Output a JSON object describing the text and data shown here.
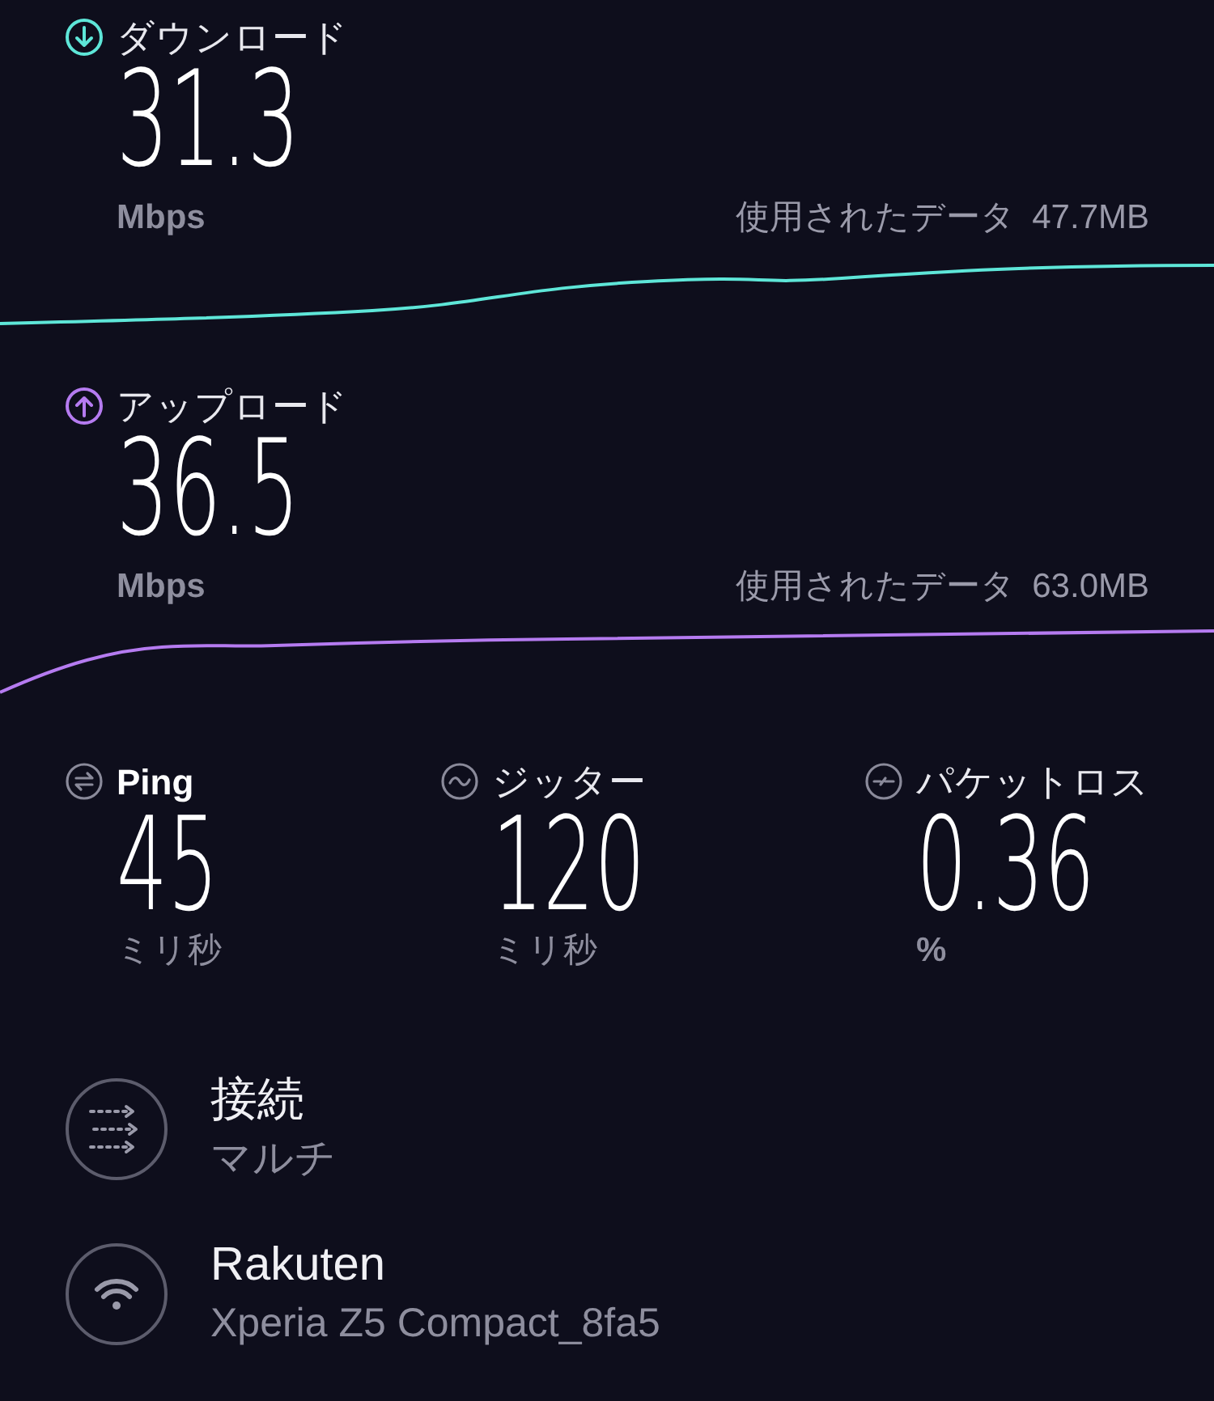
{
  "speeds": [
    {
      "kind": "download",
      "label": "ダウンロード",
      "value": "31.3",
      "unit": "Mbps",
      "data_label": "使用されたデータ",
      "data_amount": "47.7MB"
    },
    {
      "kind": "upload",
      "label": "アップロード",
      "value": "36.5",
      "unit": "Mbps",
      "data_label": "使用されたデータ",
      "data_amount": "63.0MB"
    }
  ],
  "metrics": [
    {
      "kind": "ping",
      "label": "Ping",
      "value": "45",
      "unit": "ミリ秒"
    },
    {
      "kind": "jitter",
      "label": "ジッター",
      "value": "120",
      "unit": "ミリ秒"
    },
    {
      "kind": "loss",
      "label": "パケットロス",
      "value": "0.36",
      "unit": "%"
    }
  ],
  "details": [
    {
      "kind": "connections",
      "title": "接続",
      "subtitle": "マルチ"
    },
    {
      "kind": "network",
      "title": "Rakuten",
      "subtitle": "Xperia Z5 Compact_8fa5"
    }
  ]
}
